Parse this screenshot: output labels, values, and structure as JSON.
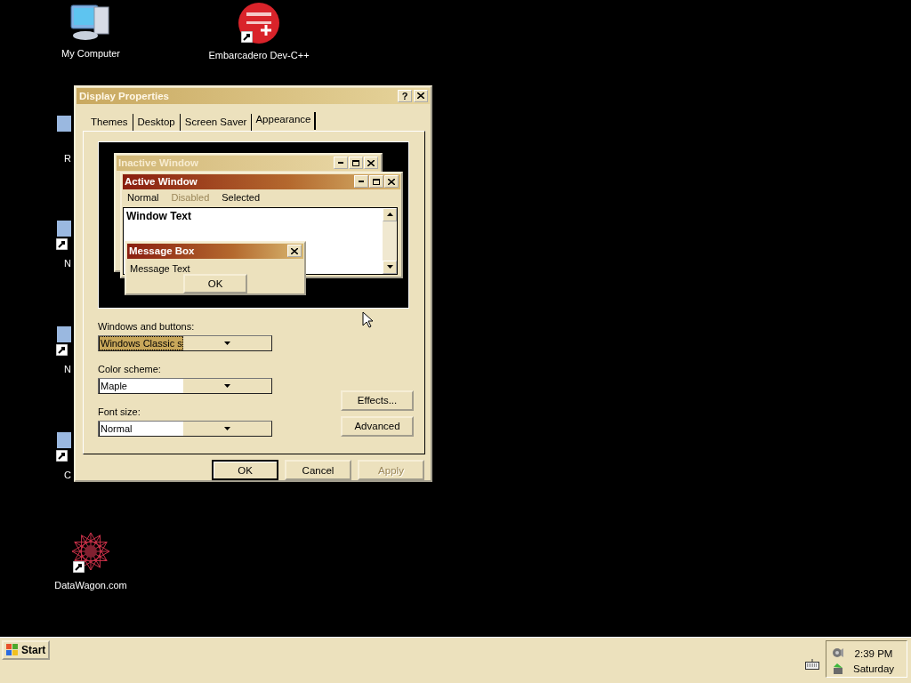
{
  "desktop_icons": [
    {
      "label": "My Computer",
      "kind": "computer"
    },
    {
      "label": "Embarcadero Dev-C++",
      "kind": "devcpp",
      "shortcut": true
    },
    {
      "label": "R",
      "kind": "partial"
    },
    {
      "label": "N",
      "kind": "partial",
      "shortcut": true
    },
    {
      "label": "N",
      "kind": "partial",
      "shortcut": true
    },
    {
      "label": "C",
      "kind": "partial",
      "shortcut": true
    },
    {
      "label": "DataWagon.com",
      "kind": "star",
      "shortcut": true
    }
  ],
  "dialog": {
    "title": "Display Properties",
    "help": "?",
    "tabs": [
      {
        "label": "Themes",
        "selected": false
      },
      {
        "label": "Desktop",
        "selected": false
      },
      {
        "label": "Screen Saver",
        "selected": false
      },
      {
        "label": "Appearance",
        "selected": true
      }
    ],
    "preview": {
      "inactive_title": "Inactive Window",
      "active_title": "Active Window",
      "menu": [
        {
          "label": "Normal",
          "disabled": false
        },
        {
          "label": "Disabled",
          "disabled": true
        },
        {
          "label": "Selected",
          "disabled": false
        }
      ],
      "window_text": "Window Text",
      "message_title": "Message Box",
      "message_text": "Message Text",
      "message_button": "OK"
    },
    "fields": [
      {
        "label": "Windows and buttons:",
        "value": "Windows Classic s",
        "focused": true
      },
      {
        "label": "Color scheme:",
        "value": "Maple"
      },
      {
        "label": "Font size:",
        "value": "Normal"
      }
    ],
    "side_buttons": [
      {
        "label": "Effects..."
      },
      {
        "label": "Advanced"
      }
    ],
    "buttons": [
      {
        "label": "OK",
        "default": true,
        "disabled": false
      },
      {
        "label": "Cancel",
        "default": false,
        "disabled": false
      },
      {
        "label": "Apply",
        "default": false,
        "disabled": true
      }
    ]
  },
  "taskbar": {
    "start": "Start",
    "clock": "2:39 PM",
    "day": "Saturday"
  }
}
